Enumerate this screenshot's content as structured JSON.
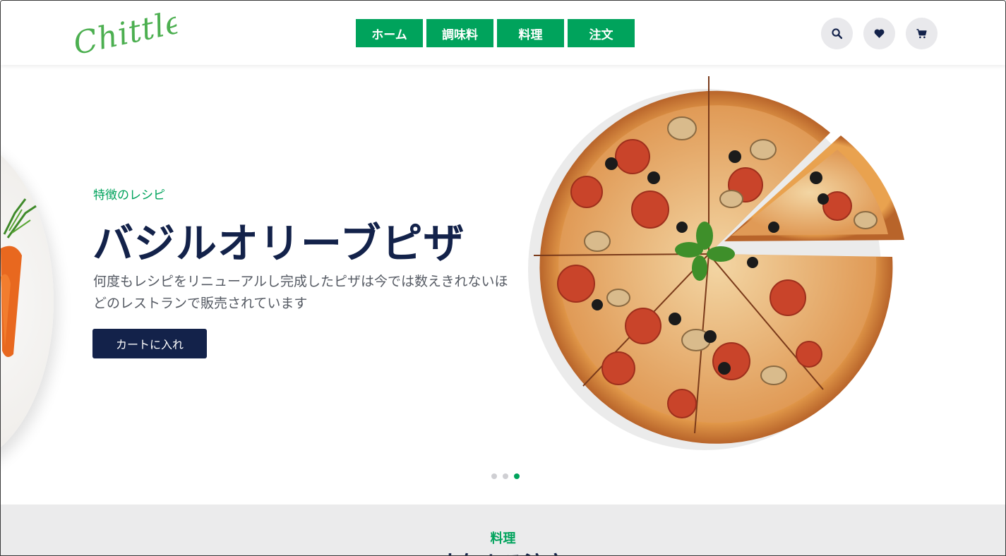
{
  "brand": {
    "logo_text": "Chittle",
    "logo_color": "#4caf50"
  },
  "nav": {
    "items": [
      {
        "label": "ホーム"
      },
      {
        "label": "調味料"
      },
      {
        "label": "料理"
      },
      {
        "label": "注文"
      }
    ]
  },
  "header_icons": [
    "search-icon",
    "heart-icon",
    "cart-icon"
  ],
  "hero": {
    "eyebrow": "特徴のレシピ",
    "title": "バジルオリーブピザ",
    "description": "何度もレシピをリニューアルし完成したピザは今では数えきれないほどのレストランで販売されています",
    "cta_label": "カートに入れ",
    "slide_count": 3,
    "active_slide": 3
  },
  "section": {
    "eyebrow": "料理",
    "title": "人気ある注文"
  },
  "colors": {
    "accent": "#00a35c",
    "navy": "#13224a",
    "section_bg": "#ebebec"
  }
}
